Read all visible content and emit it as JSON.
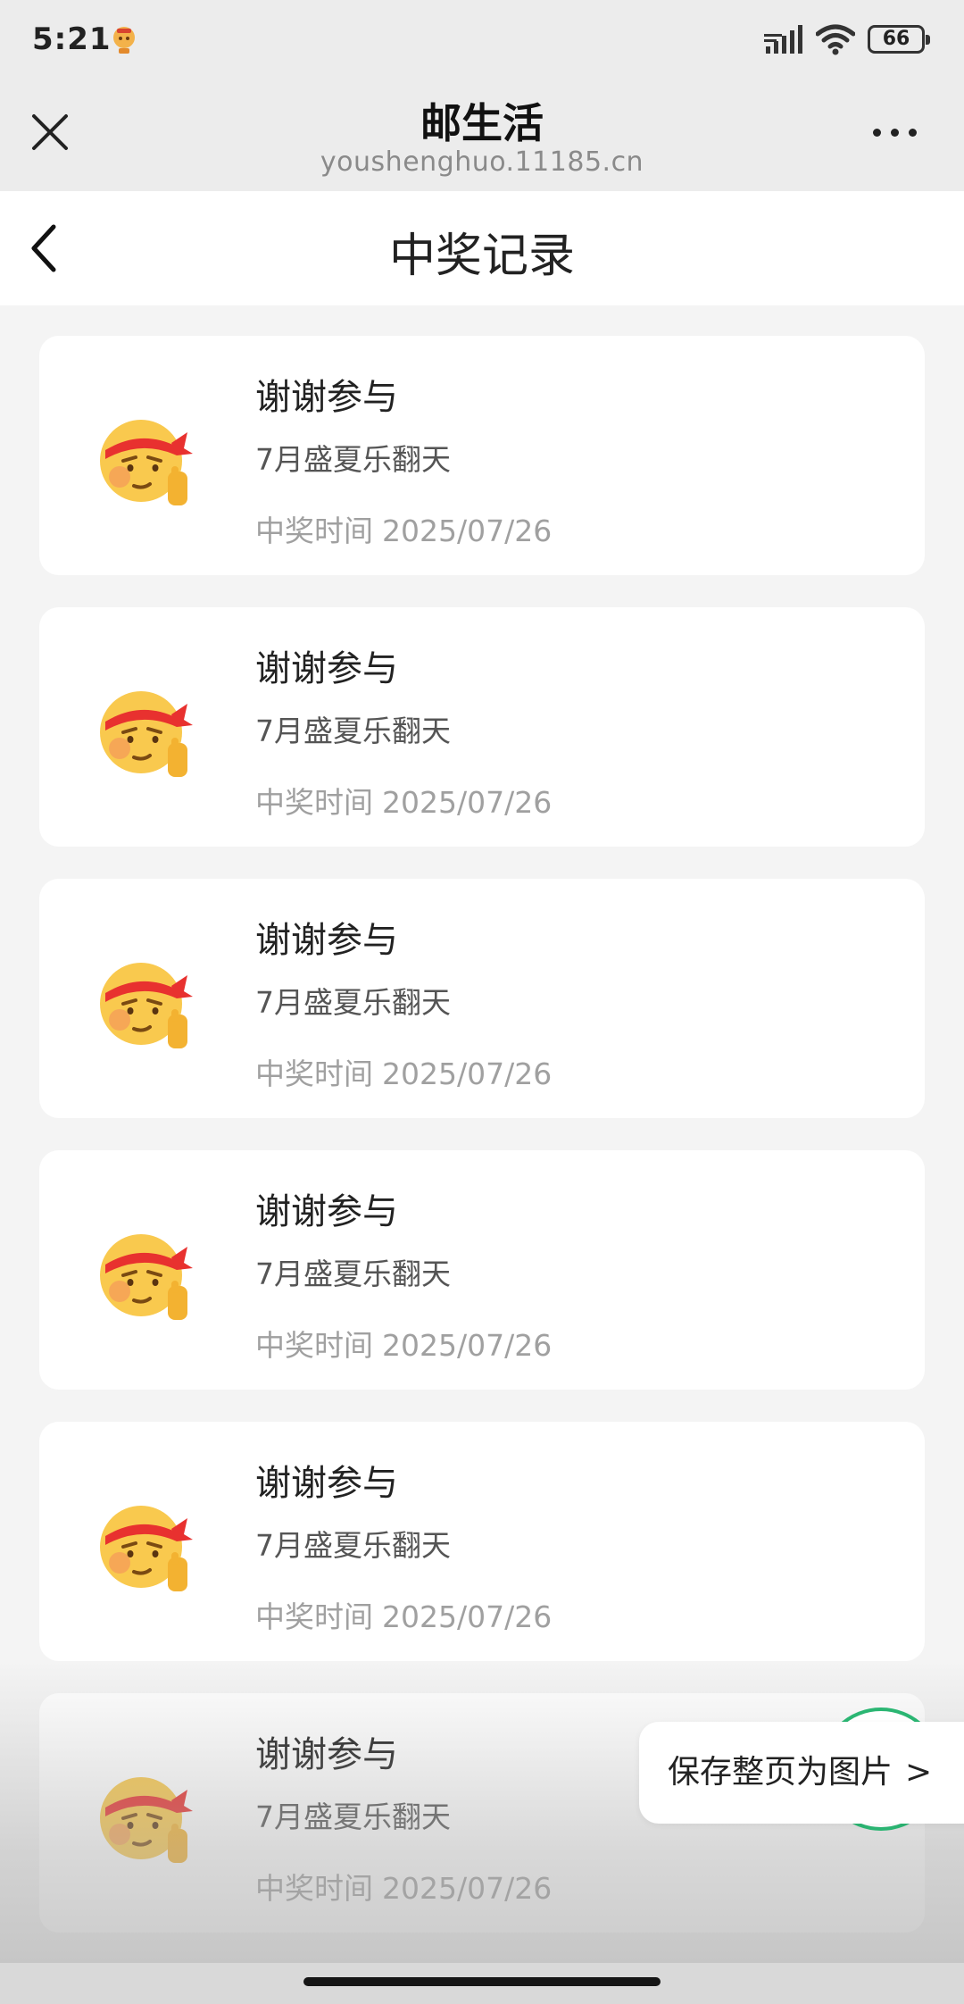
{
  "status_bar": {
    "time": "5:21",
    "battery": "66",
    "icons": [
      "app-notification-icon",
      "signal-icon",
      "wifi-icon",
      "battery-icon"
    ]
  },
  "browser": {
    "title": "邮生活",
    "url": "youshenghuo.11185.cn",
    "close_icon": "close-icon",
    "more_icon": "more-icon"
  },
  "nav": {
    "title": "中奖记录",
    "back_icon": "chevron-left-icon"
  },
  "records": [
    {
      "title": "谢谢参与",
      "activity": "7月盛夏乐翻天",
      "time_label": "中奖时间",
      "time": "2025/07/26",
      "icon": "salute-face-icon"
    },
    {
      "title": "谢谢参与",
      "activity": "7月盛夏乐翻天",
      "time_label": "中奖时间",
      "time": "2025/07/26",
      "icon": "salute-face-icon"
    },
    {
      "title": "谢谢参与",
      "activity": "7月盛夏乐翻天",
      "time_label": "中奖时间",
      "time": "2025/07/26",
      "icon": "salute-face-icon"
    },
    {
      "title": "谢谢参与",
      "activity": "7月盛夏乐翻天",
      "time_label": "中奖时间",
      "time": "2025/07/26",
      "icon": "salute-face-icon"
    },
    {
      "title": "谢谢参与",
      "activity": "7月盛夏乐翻天",
      "time_label": "中奖时间",
      "time": "2025/07/26",
      "icon": "salute-face-icon"
    },
    {
      "title": "谢谢参与",
      "activity": "7月盛夏乐翻天",
      "time_label": "中奖时间",
      "time": "2025/07/26",
      "icon": "salute-face-icon"
    }
  ],
  "save_button": {
    "label": "保存整页为图片",
    "chevron": ">"
  },
  "colors": {
    "accent_green": "#2bb673",
    "headband_red": "#e8312f",
    "face_yellow": "#f9c94e"
  }
}
